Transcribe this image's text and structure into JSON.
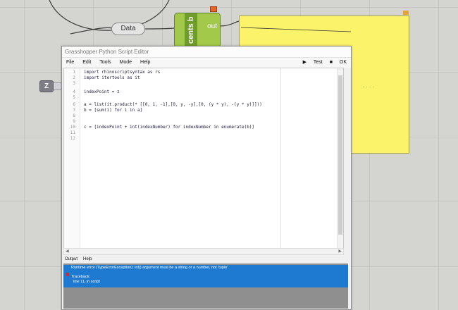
{
  "canvas": {
    "data_param_label": "Data",
    "component_title": "cents b",
    "component_output_label": "out",
    "panel_text": "",
    "panel_dots": "· · · ·",
    "z_node_label": "Z"
  },
  "editor": {
    "title": "Grasshopper Python Script Editor",
    "menu": [
      "File",
      "Edit",
      "Tools",
      "Mode",
      "Help"
    ],
    "toolbar": {
      "test_label": "Test",
      "ok_label": "OK"
    },
    "code_lines": [
      {
        "num": "1",
        "text": "import rhinoscriptsyntax as rs"
      },
      {
        "num": "2",
        "text": "import itertools as it"
      },
      {
        "num": "3",
        "text": ""
      },
      {
        "num": "4",
        "text": "indexPoint = z"
      },
      {
        "num": "5",
        "text": ""
      },
      {
        "num": "6",
        "text": "a = list(it.product(* [[0, 1, -1],[0, y, -y],[0, (y * y), -(y * y)]]))"
      },
      {
        "num": "7",
        "text": "b = [sum(i) for i in a]"
      },
      {
        "num": "8",
        "text": ""
      },
      {
        "num": "9",
        "text": ""
      },
      {
        "num": "10",
        "text": "c = [indexPoint + int(indexNumber) for indexNumber in enumerate(b)]"
      },
      {
        "num": "11",
        "text": ""
      },
      {
        "num": "12",
        "text": ""
      }
    ],
    "output_tabs": [
      "Output",
      "Help"
    ],
    "output": {
      "error_line": "Runtime error (TypeErrorException): int() argument must be a string or a number, not 'tuple'",
      "traceback_label": "Traceback:",
      "traceback_detail": "line 11, in script"
    }
  }
}
